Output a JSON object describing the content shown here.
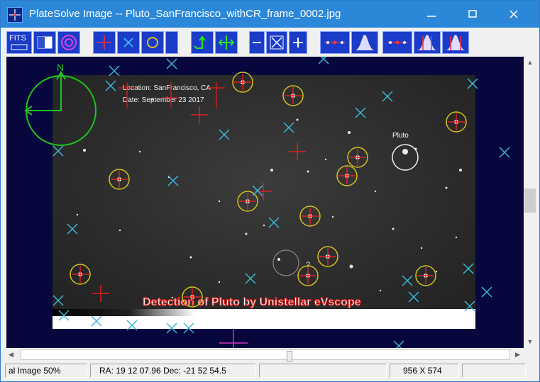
{
  "window": {
    "title": "PlateSolve Image -- Pluto_SanFrancisco_withCR_frame_0002.jpg",
    "controls": [
      "minimize-icon",
      "maximize-icon",
      "close-icon"
    ]
  },
  "toolbar": {
    "fits_label": "FITS",
    "buttons": [
      "fits-button",
      "split-view-button",
      "target-rings-button",
      "red-star-button",
      "cyan-star-button",
      "yellow-circle-button",
      "blank-button",
      "north-arrow-button",
      "pan-arrows-button",
      "zoom-out-button",
      "fit-window-button",
      "zoom-in-button",
      "red-markers-button",
      "histogram-button",
      "red-markers-2-button",
      "histogram-red-button",
      "histogram-2-button"
    ]
  },
  "image": {
    "compass_label": "N",
    "overlay_location": "Location: SanFrancisco, CA",
    "overlay_date": "Date: September 23 2017",
    "pluto_label": "Pluto",
    "question_label": "?",
    "caption": "Detection of Pluto by Unistellar eVscope"
  },
  "status": {
    "zoom_text": "al Image 50%",
    "coords_text": "RA: 19 12 07.96  Dec: -21 52 54.5",
    "size_text": "956 X 574"
  },
  "colors": {
    "titlebar": "#2b87d8",
    "toolbar_button": "#1a3cc8",
    "viewport": "#07073d",
    "marker_red": "#e0201e",
    "marker_cyan": "#38b8d8",
    "marker_yellow": "#d6c31a",
    "compass_green": "#1fc21f"
  }
}
